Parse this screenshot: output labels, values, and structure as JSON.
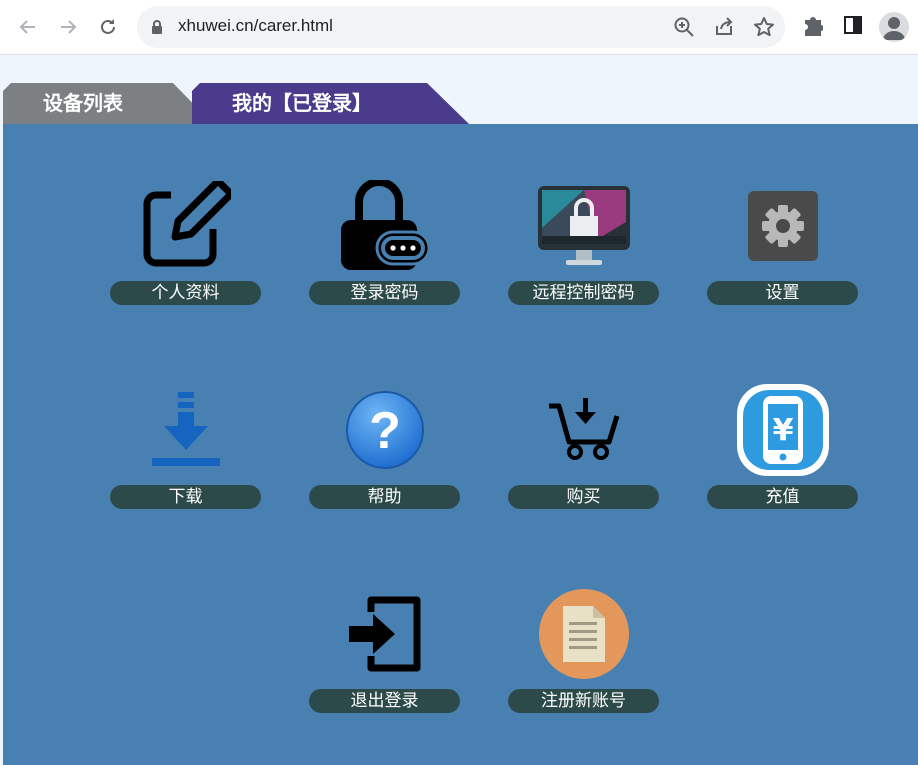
{
  "browser": {
    "url": "xhuwei.cn/carer.html"
  },
  "tabs": [
    {
      "label": "设备列表"
    },
    {
      "label": "我的【已登录】"
    }
  ],
  "tiles": [
    {
      "label": "个人资料",
      "icon": "edit-icon"
    },
    {
      "label": "登录密码",
      "icon": "password-lock-icon"
    },
    {
      "label": "远程控制密码",
      "icon": "remote-monitor-lock-icon"
    },
    {
      "label": "设置",
      "icon": "gear-icon"
    },
    {
      "label": "下载",
      "icon": "download-icon"
    },
    {
      "label": "帮助",
      "icon": "help-icon"
    },
    {
      "label": "购买",
      "icon": "cart-icon"
    },
    {
      "label": "充值",
      "icon": "recharge-phone-icon"
    },
    {
      "label": "退出登录",
      "icon": "logout-icon"
    },
    {
      "label": "注册新账号",
      "icon": "document-icon"
    }
  ],
  "colors": {
    "panel": "#4880b1",
    "label_bg": "#2d4a4a",
    "active_tab": "#4b3b8c",
    "inactive_tab": "#7c8082"
  }
}
